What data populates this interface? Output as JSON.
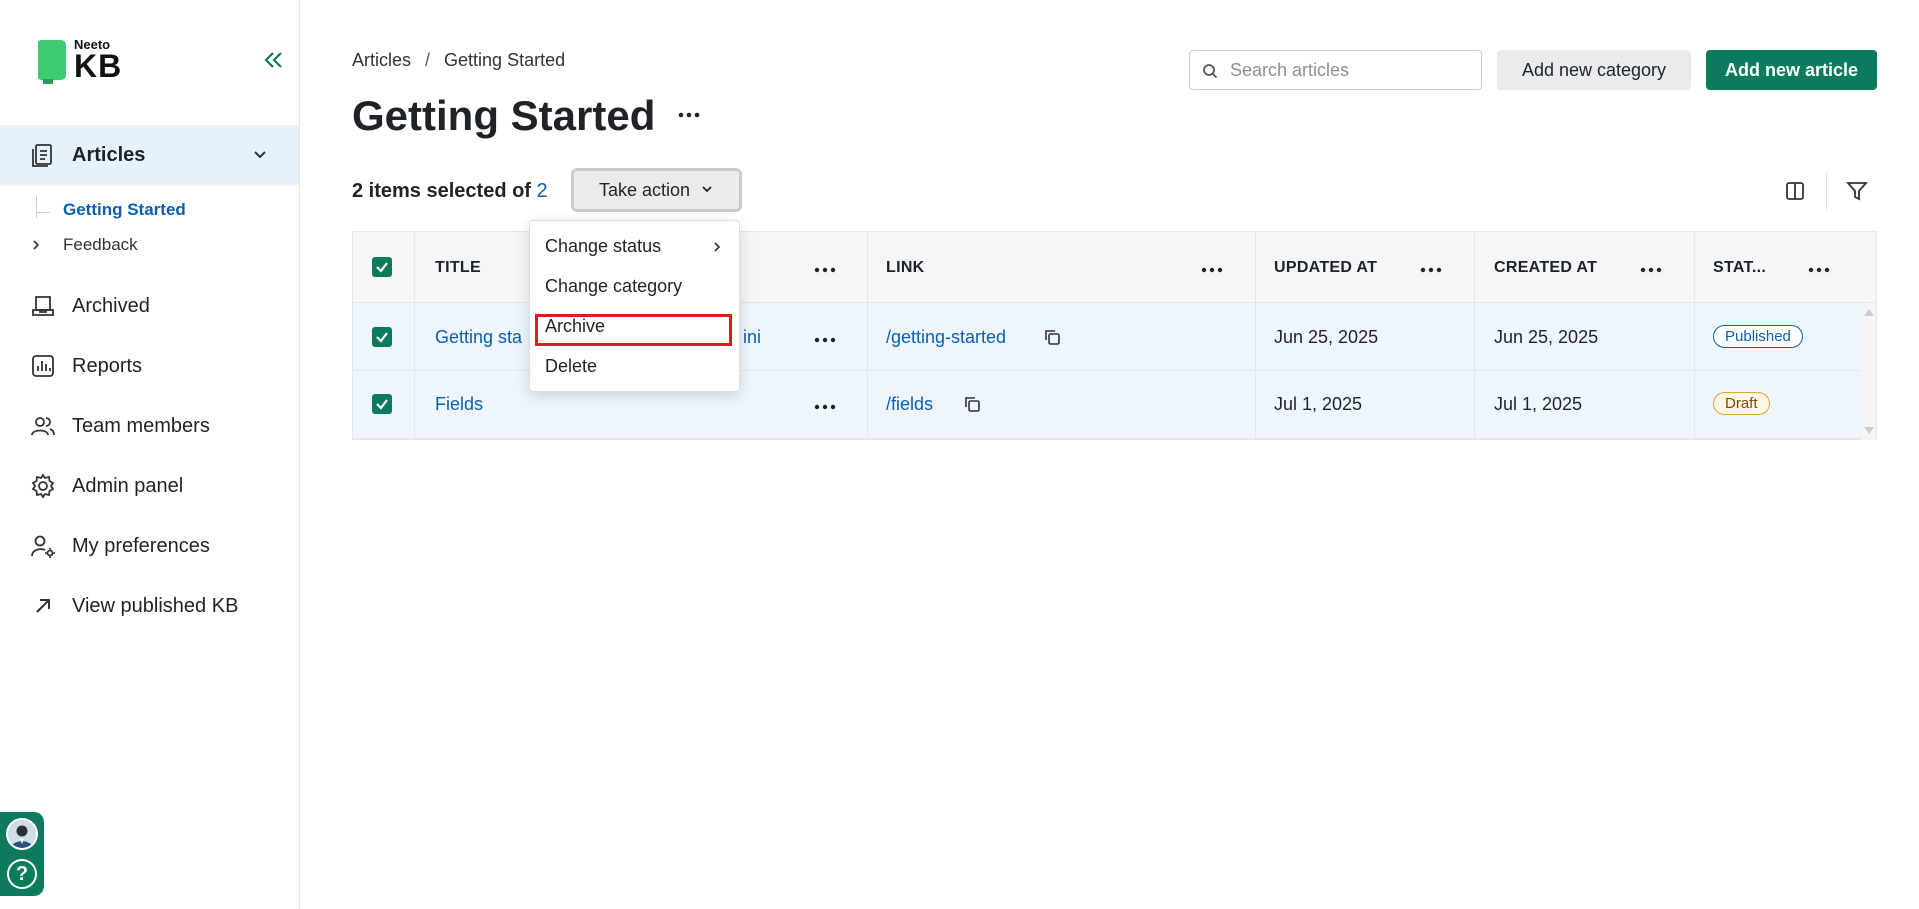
{
  "brand": {
    "small": "Neeto",
    "big": "KB",
    "color": "#0b7a5d"
  },
  "sidebar": {
    "active_item": {
      "label": "Articles",
      "icon": "articles-icon"
    },
    "sub_items": [
      {
        "label": "Getting Started",
        "active": true
      },
      {
        "label": "Feedback",
        "active": false
      }
    ],
    "items": [
      {
        "label": "Archived",
        "icon": "archive-icon"
      },
      {
        "label": "Reports",
        "icon": "reports-icon"
      },
      {
        "label": "Team members",
        "icon": "team-icon"
      },
      {
        "label": "Admin panel",
        "icon": "gear-icon"
      },
      {
        "label": "My preferences",
        "icon": "user-settings-icon"
      },
      {
        "label": "View published KB",
        "icon": "external-link-icon"
      }
    ],
    "help_label": "?"
  },
  "breadcrumb": {
    "root": "Articles",
    "separator": "/",
    "current": "Getting Started"
  },
  "page_title": "Getting Started",
  "search": {
    "placeholder": "Search articles",
    "value": ""
  },
  "buttons": {
    "add_category": "Add new category",
    "add_article": "Add new article"
  },
  "selection": {
    "prefix": "2 items selected of",
    "total": "2"
  },
  "take_action": {
    "label": "Take action"
  },
  "dropdown": {
    "items": [
      {
        "label": "Change status",
        "has_submenu": true
      },
      {
        "label": "Change category"
      },
      {
        "label": "Archive",
        "highlighted": true
      },
      {
        "label": "Delete"
      }
    ]
  },
  "table": {
    "columns": [
      "TITLE",
      "LINK",
      "UPDATED AT",
      "CREATED AT",
      "STAT..."
    ],
    "rows": [
      {
        "title_visible_start": "Getting sta",
        "title_visible_end": "ini",
        "link": "/getting-started",
        "updated_at": "Jun 25, 2025",
        "created_at": "Jun 25, 2025",
        "status": "Published"
      },
      {
        "title": "Fields",
        "link": "/fields",
        "updated_at": "Jul 1, 2025",
        "created_at": "Jul 1, 2025",
        "status": "Draft"
      }
    ]
  }
}
